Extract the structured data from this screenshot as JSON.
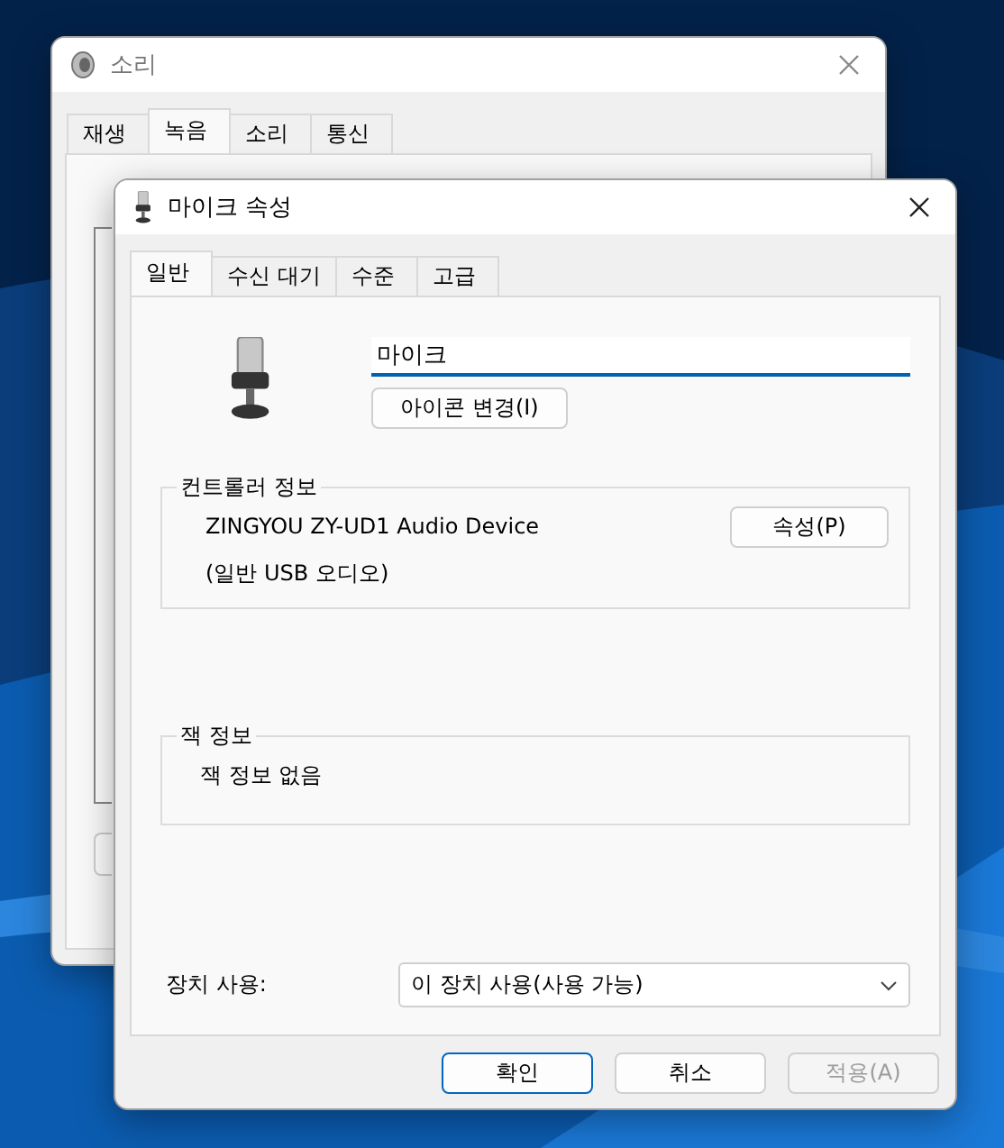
{
  "back_window": {
    "title": "소리",
    "tabs": [
      {
        "label": "재생",
        "selected": false
      },
      {
        "label": "녹음",
        "selected": true
      },
      {
        "label": "소리",
        "selected": false
      },
      {
        "label": "통신",
        "selected": false
      }
    ]
  },
  "dialog": {
    "title": "마이크 속성",
    "tabs": [
      {
        "label": "일반",
        "selected": true
      },
      {
        "label": "수신 대기",
        "selected": false
      },
      {
        "label": "수준",
        "selected": false
      },
      {
        "label": "고급",
        "selected": false
      }
    ],
    "name_field": {
      "value": "마이크"
    },
    "change_icon_button": "아이콘 변경(I)",
    "controller": {
      "heading": "컨트롤러 정보",
      "device": "ZINGYOU ZY-UD1 Audio Device",
      "type": "(일반 USB 오디오)",
      "button": "속성(P)"
    },
    "jack": {
      "heading": "잭 정보",
      "text": "잭 정보 없음"
    },
    "usage": {
      "label": "장치 사용:",
      "value": "이 장치 사용(사용 가능)"
    },
    "buttons": [
      {
        "label": "확인",
        "default": true,
        "disabled": false
      },
      {
        "label": "취소",
        "default": false,
        "disabled": false
      },
      {
        "label": "적용(A)",
        "default": false,
        "disabled": true
      }
    ]
  }
}
